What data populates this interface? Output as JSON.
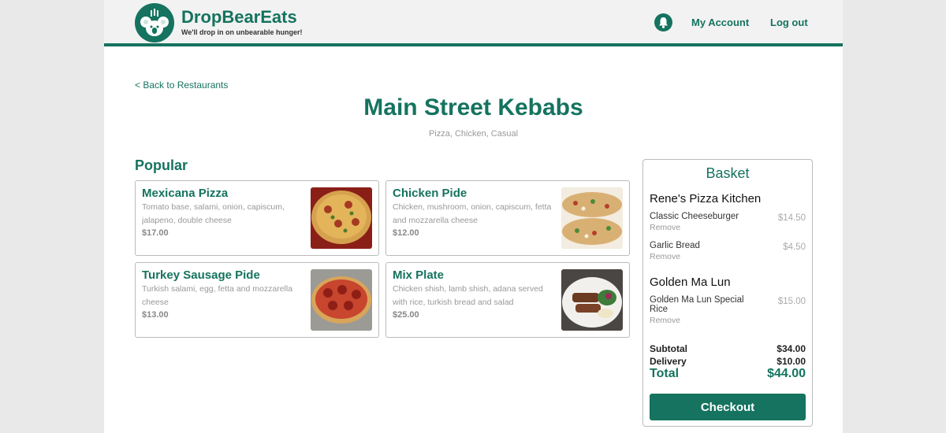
{
  "header": {
    "brand": "DropBearEats",
    "tagline": "We'll drop in on unbearable hunger!",
    "logo_icon": "koala-icon",
    "bell_icon": "bell-icon",
    "my_account": "My Account",
    "logout": "Log out"
  },
  "restaurant": {
    "back_link": "< Back to Restaurants",
    "name": "Main Street Kebabs",
    "cuisine": "Pizza, Chicken, Casual"
  },
  "popular": {
    "heading": "Popular",
    "items": [
      {
        "name": "Mexicana Pizza",
        "description": "Tomato base, salami, onion, capiscum, jalapeno, double cheese",
        "price": "$17.00"
      },
      {
        "name": "Chicken Pide",
        "description": "Chicken, mushroom, onion, capiscum, fetta and mozzarella cheese",
        "price": "$12.00"
      },
      {
        "name": "Turkey Sausage Pide",
        "description": "Turkish salami, egg, fetta and mozzarella cheese",
        "price": "$13.00"
      },
      {
        "name": "Mix Plate",
        "description": "Chicken shish, lamb shish, adana served with rice, turkish bread and salad",
        "price": "$25.00"
      }
    ]
  },
  "basket": {
    "title": "Basket",
    "groups": [
      {
        "restaurant": "Rene's Pizza Kitchen",
        "items": [
          {
            "name": "Classic Cheeseburger",
            "price": "$14.50",
            "remove": "Remove"
          },
          {
            "name": "Garlic Bread",
            "price": "$4.50",
            "remove": "Remove"
          }
        ]
      },
      {
        "restaurant": "Golden Ma Lun",
        "items": [
          {
            "name": "Golden Ma Lun Special Rice",
            "price": "$15.00",
            "remove": "Remove"
          }
        ]
      }
    ],
    "subtotal_label": "Subtotal",
    "subtotal": "$34.00",
    "delivery_label": "Delivery",
    "delivery": "$10.00",
    "total_label": "Total",
    "total": "$44.00",
    "checkout": "Checkout"
  },
  "colors": {
    "brand": "#15735f",
    "muted": "#999999",
    "background": "#e9e9ea"
  }
}
